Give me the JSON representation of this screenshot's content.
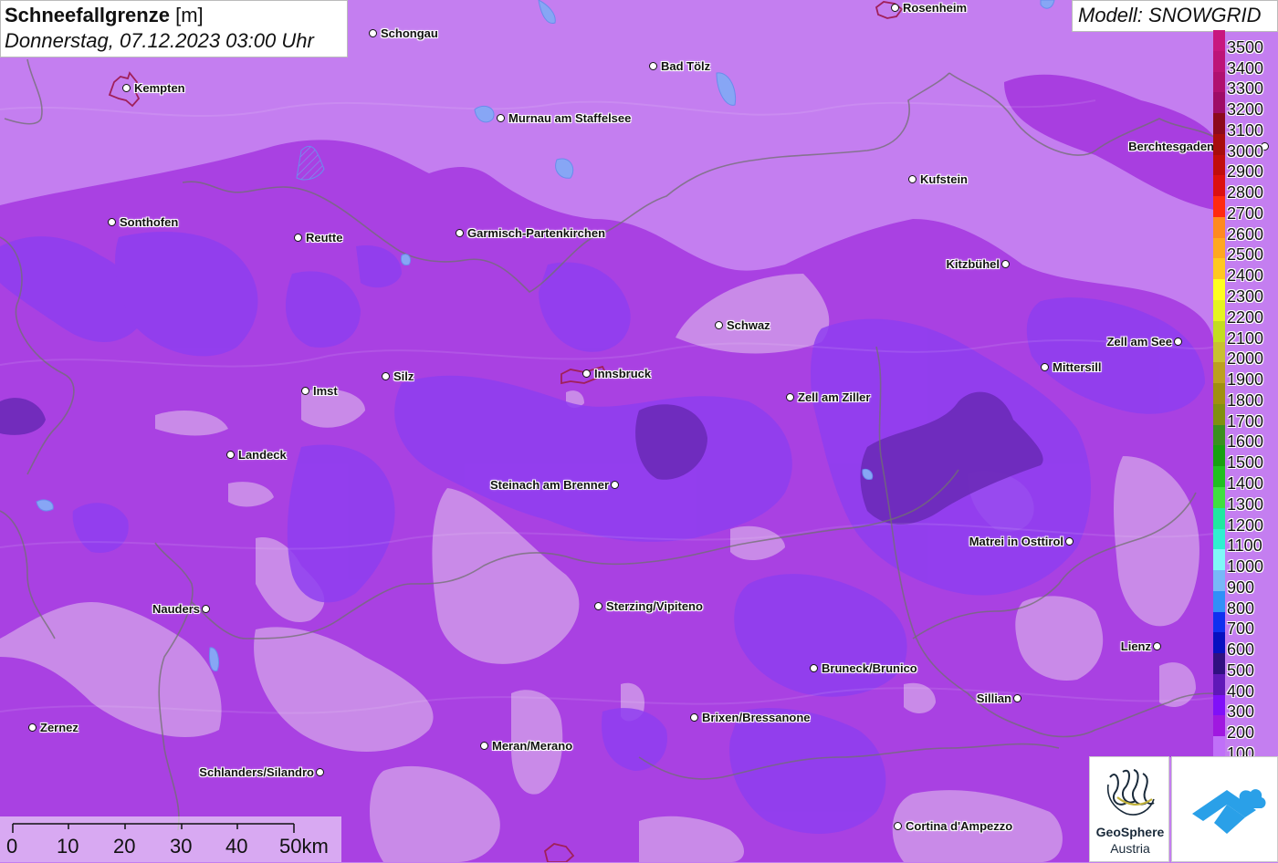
{
  "title": {
    "main": "Schneefallgrenze",
    "unit": "[m]",
    "date": "Donnerstag, 07.12.2023 03:00 Uhr"
  },
  "model_label": "Modell: SNOWGRID",
  "legend": [
    {
      "label": "3500",
      "color": "#c8177f"
    },
    {
      "label": "3400",
      "color": "#bd1478"
    },
    {
      "label": "3300",
      "color": "#b01070"
    },
    {
      "label": "3200",
      "color": "#9e0c66"
    },
    {
      "label": "3100",
      "color": "#8c0a1c"
    },
    {
      "label": "3000",
      "color": "#a80d0d"
    },
    {
      "label": "2900",
      "color": "#c10d0d"
    },
    {
      "label": "2800",
      "color": "#dc1010"
    },
    {
      "label": "2700",
      "color": "#ff2a10"
    },
    {
      "label": "2600",
      "color": "#ff8a20"
    },
    {
      "label": "2500",
      "color": "#ffa820"
    },
    {
      "label": "2400",
      "color": "#ffc820"
    },
    {
      "label": "2300",
      "color": "#ffff20"
    },
    {
      "label": "2200",
      "color": "#e5f520"
    },
    {
      "label": "2100",
      "color": "#c3dd20"
    },
    {
      "label": "2000",
      "color": "#c8c030"
    },
    {
      "label": "1900",
      "color": "#bca020"
    },
    {
      "label": "1800",
      "color": "#a09010"
    },
    {
      "label": "1700",
      "color": "#809010"
    },
    {
      "label": "1600",
      "color": "#3a9020"
    },
    {
      "label": "1500",
      "color": "#18a010"
    },
    {
      "label": "1400",
      "color": "#20c020"
    },
    {
      "label": "1300",
      "color": "#40e040"
    },
    {
      "label": "1200",
      "color": "#20e8a0"
    },
    {
      "label": "1100",
      "color": "#30f0d0"
    },
    {
      "label": "1000",
      "color": "#80f8f8"
    },
    {
      "label": "900",
      "color": "#78b8f8"
    },
    {
      "label": "800",
      "color": "#3090f8"
    },
    {
      "label": "700",
      "color": "#1030f0"
    },
    {
      "label": "600",
      "color": "#0810c0"
    },
    {
      "label": "500",
      "color": "#301080"
    },
    {
      "label": "400",
      "color": "#6018b8"
    },
    {
      "label": "300",
      "color": "#8010f8"
    },
    {
      "label": "200",
      "color": "#a018e0"
    },
    {
      "label": "100",
      "color": "#c070f8"
    }
  ],
  "cities": [
    {
      "name": "Rosenheim",
      "side": "right"
    },
    {
      "name": "Schongau",
      "side": "right"
    },
    {
      "name": "Bad Tölz",
      "side": "right"
    },
    {
      "name": "Kempten",
      "side": "right"
    },
    {
      "name": "Murnau am Staffelsee",
      "side": "right"
    },
    {
      "name": "Berchtesgaden",
      "side": "left"
    },
    {
      "name": "Kufstein",
      "side": "right"
    },
    {
      "name": "Sonthofen",
      "side": "right"
    },
    {
      "name": "Reutte",
      "side": "right"
    },
    {
      "name": "Garmisch-Partenkirchen",
      "side": "right"
    },
    {
      "name": "Kitzbühel",
      "side": "left"
    },
    {
      "name": "Schwaz",
      "side": "right"
    },
    {
      "name": "Zell am See",
      "side": "left"
    },
    {
      "name": "Mittersill",
      "side": "right"
    },
    {
      "name": "Imst",
      "side": "right"
    },
    {
      "name": "Silz",
      "side": "right"
    },
    {
      "name": "Innsbruck",
      "side": "right"
    },
    {
      "name": "Zell am Ziller",
      "side": "right"
    },
    {
      "name": "Landeck",
      "side": "right"
    },
    {
      "name": "Steinach am Brenner",
      "side": "left"
    },
    {
      "name": "Matrei in Osttirol",
      "side": "left"
    },
    {
      "name": "Nauders",
      "side": "left"
    },
    {
      "name": "Sterzing/Vipiteno",
      "side": "right"
    },
    {
      "name": "Lienz",
      "side": "left"
    },
    {
      "name": "Bruneck/Brunico",
      "side": "right"
    },
    {
      "name": "Sillian",
      "side": "left"
    },
    {
      "name": "Brixen/Bressanone",
      "side": "right"
    },
    {
      "name": "Zernez",
      "side": "right"
    },
    {
      "name": "Meran/Merano",
      "side": "right"
    },
    {
      "name": "Schlanders/Silandro",
      "side": "left"
    },
    {
      "name": "Cortina d'Ampezzo",
      "side": "right"
    }
  ],
  "scale": {
    "ticks": [
      "0",
      "10",
      "20",
      "30",
      "40",
      "50km"
    ]
  },
  "logos": {
    "geosphere_line1": "GeoSphere",
    "geosphere_line2": "Austria"
  }
}
